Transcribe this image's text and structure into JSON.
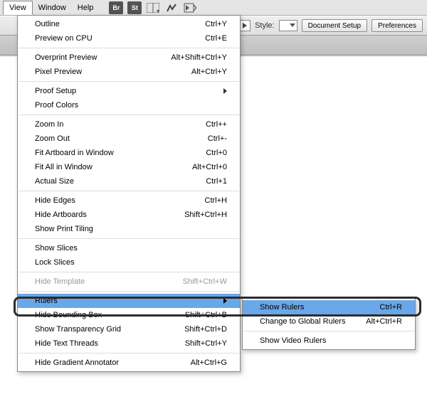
{
  "menubar": {
    "view": "View",
    "window": "Window",
    "help": "Help"
  },
  "toolbar": {
    "style_label": "Style:",
    "doc_setup": "Document Setup",
    "prefs": "Preferences"
  },
  "menu": {
    "outline": {
      "label": "Outline",
      "shortcut": "Ctrl+Y"
    },
    "cpu_preview": {
      "label": "Preview on CPU",
      "shortcut": "Ctrl+E"
    },
    "overprint": {
      "label": "Overprint Preview",
      "shortcut": "Alt+Shift+Ctrl+Y"
    },
    "pixel": {
      "label": "Pixel Preview",
      "shortcut": "Alt+Ctrl+Y"
    },
    "proof_setup": {
      "label": "Proof Setup"
    },
    "proof_colors": {
      "label": "Proof Colors"
    },
    "zoom_in": {
      "label": "Zoom In",
      "shortcut": "Ctrl++"
    },
    "zoom_out": {
      "label": "Zoom Out",
      "shortcut": "Ctrl+-"
    },
    "fit_artboard": {
      "label": "Fit Artboard in Window",
      "shortcut": "Ctrl+0"
    },
    "fit_all": {
      "label": "Fit All in Window",
      "shortcut": "Alt+Ctrl+0"
    },
    "actual": {
      "label": "Actual Size",
      "shortcut": "Ctrl+1"
    },
    "hide_edges": {
      "label": "Hide Edges",
      "shortcut": "Ctrl+H"
    },
    "hide_artboards": {
      "label": "Hide Artboards",
      "shortcut": "Shift+Ctrl+H"
    },
    "print_tiling": {
      "label": "Show Print Tiling"
    },
    "show_slices": {
      "label": "Show Slices"
    },
    "lock_slices": {
      "label": "Lock Slices"
    },
    "hide_template": {
      "label": "Hide Template",
      "shortcut": "Shift+Ctrl+W"
    },
    "rulers": {
      "label": "Rulers"
    },
    "hide_bbox": {
      "label": "Hide Bounding Box",
      "shortcut": "Shift+Ctrl+B"
    },
    "transparency": {
      "label": "Show Transparency Grid",
      "shortcut": "Shift+Ctrl+D"
    },
    "text_threads": {
      "label": "Hide Text Threads",
      "shortcut": "Shift+Ctrl+Y"
    },
    "gradient": {
      "label": "Hide Gradient Annotator",
      "shortcut": "Alt+Ctrl+G"
    }
  },
  "submenu": {
    "show_rulers": {
      "label": "Show Rulers",
      "shortcut": "Ctrl+R"
    },
    "global_rulers": {
      "label": "Change to Global Rulers",
      "shortcut": "Alt+Ctrl+R"
    },
    "video_rulers": {
      "label": "Show Video Rulers"
    }
  }
}
